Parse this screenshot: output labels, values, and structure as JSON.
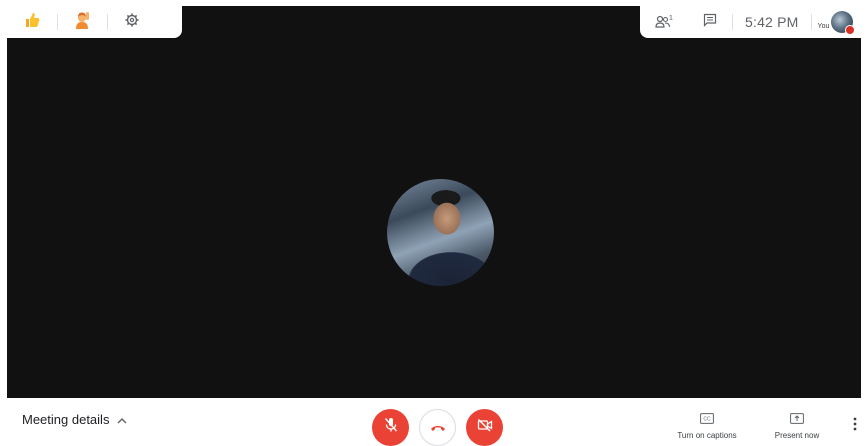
{
  "top_left": {
    "reactions": [
      {
        "name": "thumbs-up-emoji",
        "glyph": "👍"
      },
      {
        "name": "raised-hand-emoji",
        "glyph": "🙋"
      }
    ],
    "settings_icon": "gear-icon"
  },
  "top_right": {
    "participants_count": "1",
    "chat_icon": "chat-icon",
    "time": "5:42 PM",
    "self_label": "You"
  },
  "bottom_bar": {
    "meeting_details_label": "Meeting details",
    "captions_label": "Turn on captions",
    "present_label": "Present now"
  },
  "colors": {
    "video_bg": "#111111",
    "red": "#ea4335",
    "text": "#202124"
  }
}
